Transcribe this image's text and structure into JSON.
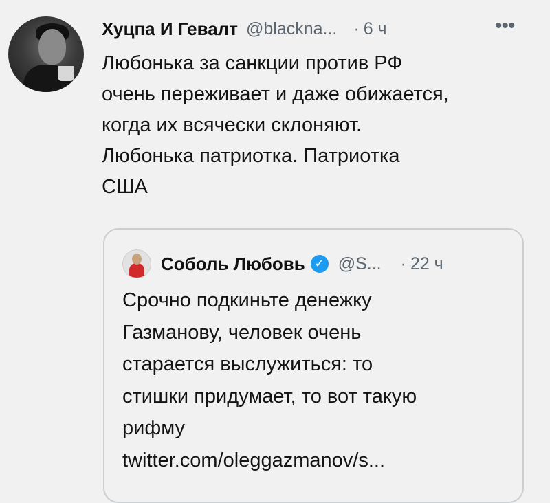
{
  "tweet": {
    "author_name": "Хуцпа И Гевалт",
    "handle": "@blackna...",
    "dot": "·",
    "time": "6 ч",
    "more_icon": "more-horizontal-icon",
    "text_lines": [
      "Любонька за санкции против РФ",
      "очень переживает и даже обижается,",
      "когда их всячески склоняют.",
      "Любонька патриотка. Патриотка",
      "США"
    ]
  },
  "quote": {
    "author_name": "Соболь Любовь",
    "verified_icon": "verified-badge-icon",
    "handle": "@S...",
    "dot": "·",
    "time": "22 ч",
    "text_lines": [
      "Срочно подкиньте денежку",
      "Газманову, человек очень",
      "старается выслужиться: то",
      "стишки придумает, то вот такую",
      "рифму",
      "twitter.com/oleggazmanov/s..."
    ]
  },
  "colors": {
    "background": "#f1f1f1",
    "secondary_text": "#5b6670",
    "verified": "#1d9bf0",
    "card_border": "#c9ced3"
  }
}
